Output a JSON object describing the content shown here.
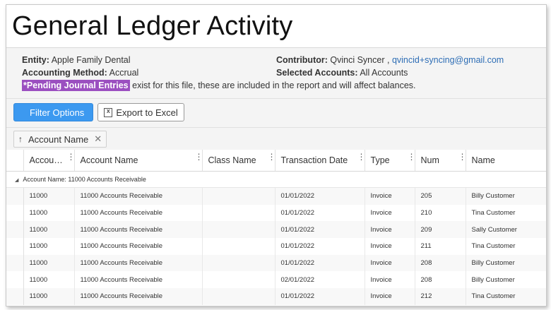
{
  "page": {
    "title": "General Ledger Activity"
  },
  "info": {
    "entity_label": "Entity:",
    "entity_value": "Apple Family Dental",
    "method_label": "Accounting Method:",
    "method_value": "Accrual",
    "contributor_label": "Contributor:",
    "contributor_name": "Qvinci Syncer ,",
    "contributor_email": "qvincid+syncing@gmail.com",
    "accounts_label": "Selected Accounts:",
    "accounts_value": "All Accounts",
    "pending_badge": "*Pending Journal Entries",
    "pending_text": "exist for this file, these are included in the report and will affect balances."
  },
  "toolbar": {
    "filter_label": "Filter Options",
    "export_label": "Export to Excel",
    "export_icon_text": "X"
  },
  "grouping": {
    "chip_arrow": "↑",
    "chip_label": "Account Name",
    "chip_close": "✕"
  },
  "columns": [
    "Accou…",
    "Account Name",
    "Class Name",
    "Transaction Date",
    "Type",
    "Num",
    "Name"
  ],
  "column_menu_glyph": "⋮",
  "group_row": {
    "toggle": "◢",
    "label": "Account Name: 11000 Accounts Receivable"
  },
  "rows": [
    {
      "account": "11000",
      "account_name": "11000 Accounts Receivable",
      "class_name": "",
      "date": "01/01/2022",
      "type": "Invoice",
      "num": "205",
      "name": "Billy Customer"
    },
    {
      "account": "11000",
      "account_name": "11000 Accounts Receivable",
      "class_name": "",
      "date": "01/01/2022",
      "type": "Invoice",
      "num": "210",
      "name": "Tina Customer"
    },
    {
      "account": "11000",
      "account_name": "11000 Accounts Receivable",
      "class_name": "",
      "date": "01/01/2022",
      "type": "Invoice",
      "num": "209",
      "name": "Sally Customer"
    },
    {
      "account": "11000",
      "account_name": "11000 Accounts Receivable",
      "class_name": "",
      "date": "01/01/2022",
      "type": "Invoice",
      "num": "211",
      "name": "Tina Customer"
    },
    {
      "account": "11000",
      "account_name": "11000 Accounts Receivable",
      "class_name": "",
      "date": "01/01/2022",
      "type": "Invoice",
      "num": "208",
      "name": "Billy Customer"
    },
    {
      "account": "11000",
      "account_name": "11000 Accounts Receivable",
      "class_name": "",
      "date": "02/01/2022",
      "type": "Invoice",
      "num": "208",
      "name": "Billy Customer"
    },
    {
      "account": "11000",
      "account_name": "11000 Accounts Receivable",
      "class_name": "",
      "date": "01/01/2022",
      "type": "Invoice",
      "num": "212",
      "name": "Tina Customer"
    }
  ]
}
